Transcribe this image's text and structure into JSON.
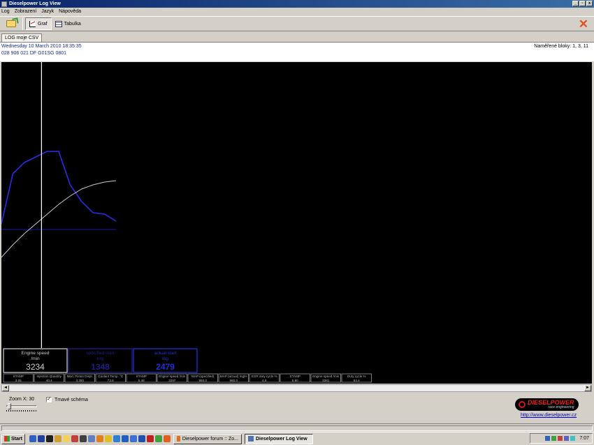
{
  "window": {
    "title": "Dieselpower Log View",
    "minimize_glyph": "_",
    "maximize_glyph": "▫",
    "close_glyph": "x"
  },
  "menu": [
    "Log",
    "Zobrazení",
    "Jazyk",
    "Nápověda"
  ],
  "toolbar": {
    "graf_label": "Graf",
    "tabulka_label": "Tabulka",
    "close_glyph": "✕"
  },
  "tabs": [
    "LOG moje CSV"
  ],
  "info": {
    "line1": "Wednesday 10 March 2010 18:35:35",
    "line2": "028 906 021 DF  G01SG  0801",
    "blocks": "Naměřené bloky: 1, 3, 11"
  },
  "cursor_readouts": [
    {
      "title": "Engine speed",
      "unit": "/min",
      "value": "3234",
      "color": "#c8c8c8"
    },
    {
      "title": "specified start",
      "unit": "mg",
      "value": "1348",
      "color": "#1e1e8a"
    },
    {
      "title": "actual start",
      "unit": "mg",
      "value": "2479",
      "color": "#2030d8"
    }
  ],
  "measure_cells": [
    {
      "label": "STAMP",
      "value": "3.05"
    },
    {
      "label": "Injection Quantity",
      "value": "40.4"
    },
    {
      "label": "Mod. Piston Displ.",
      "value": "3.780"
    },
    {
      "label": "Coolant Temp. °C",
      "value": "73.8"
    },
    {
      "label": "STAMP",
      "value": "5.48"
    },
    {
      "label": "Engine speed /min",
      "value": "3297"
    },
    {
      "label": "MAP (specified)",
      "value": "950.0"
    },
    {
      "label": "MAP (actual) mg/H",
      "value": "980.0"
    },
    {
      "label": "EGR duty cycle %",
      "value": "4.8"
    },
    {
      "label": "STAMP",
      "value": "5.90"
    },
    {
      "label": "Engine speed /min",
      "value": "3381"
    },
    {
      "label": "Duty cycle %",
      "value": "84.4"
    }
  ],
  "scroll": {
    "left_glyph": "◄",
    "right_glyph": "►"
  },
  "bottom": {
    "zoom_label": "Zoom X: 30",
    "zoom_value": 0.05,
    "dark_scheme_label": "Tmavé schéma",
    "dark_scheme_checked": "✓"
  },
  "logo": {
    "brand": "DIESELPOWER",
    "sub": "race engineering"
  },
  "link": "http://www.dieselpower.cz",
  "taskbar": {
    "start_label": "Start",
    "tasks": [
      {
        "label": "Dieselpower forum :: Zo...",
        "active": false
      },
      {
        "label": "Dieselpower Log View",
        "active": true
      }
    ],
    "clock": "7:07"
  },
  "chart_data": {
    "type": "line",
    "x": [
      0,
      1,
      2,
      3,
      4,
      5,
      6,
      7,
      8,
      9,
      10
    ],
    "series": [
      {
        "name": "actual start",
        "color": "#2a2aee",
        "values": [
          0.42,
          0.6,
          0.64,
          0.66,
          0.68,
          0.68,
          0.56,
          0.5,
          0.46,
          0.455,
          0.43
        ]
      },
      {
        "name": "specified start",
        "color": "#1818b0",
        "values": [
          0.4,
          0.4,
          0.4,
          0.4,
          0.4,
          0.4,
          0.4,
          0.4,
          0.4,
          0.4,
          0.4
        ]
      },
      {
        "name": "Engine speed",
        "color": "#c8c8c8",
        "values": [
          0.3,
          0.345,
          0.385,
          0.42,
          0.455,
          0.49,
          0.52,
          0.545,
          0.56,
          0.57,
          0.575
        ]
      }
    ],
    "cursor_x": 3.5,
    "ylim": [
      0,
      1
    ],
    "background": "#000000",
    "grid": false
  }
}
